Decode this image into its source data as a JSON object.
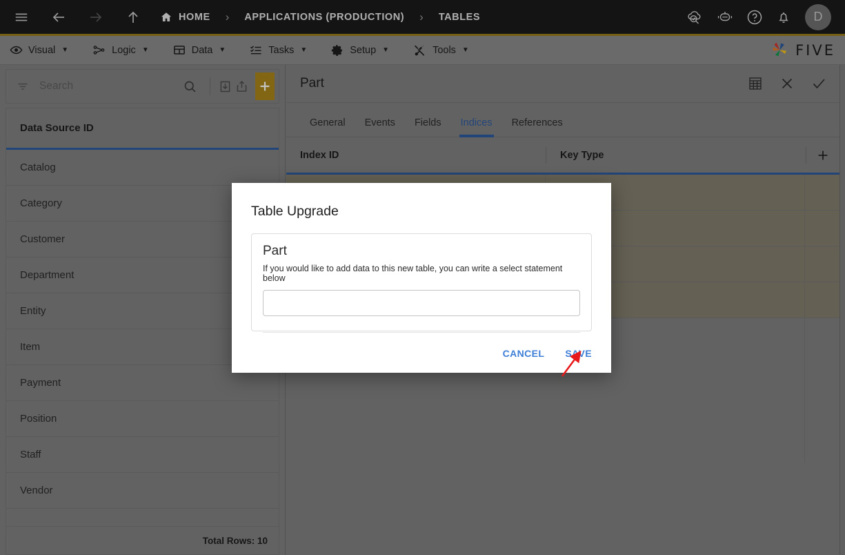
{
  "topbar": {
    "menu_icon": "hamburger-icon",
    "back_icon": "arrow-left-icon",
    "forward_icon": "arrow-right-icon",
    "up_icon": "arrow-up-icon",
    "breadcrumbs": [
      {
        "label": "HOME",
        "icon": "home-icon"
      },
      {
        "label": "APPLICATIONS (PRODUCTION)"
      },
      {
        "label": "TABLES"
      }
    ],
    "separator": "›",
    "right_icons": [
      {
        "name": "cloud-check-icon"
      },
      {
        "name": "robot-assistant-icon"
      },
      {
        "name": "help-icon"
      },
      {
        "name": "notifications-bell-icon"
      }
    ],
    "avatar_initial": "D"
  },
  "menubar": {
    "items": [
      {
        "label": "Visual",
        "icon": "eye-icon"
      },
      {
        "label": "Logic",
        "icon": "workflow-icon"
      },
      {
        "label": "Data",
        "icon": "table-grid-icon"
      },
      {
        "label": "Tasks",
        "icon": "checklist-icon"
      },
      {
        "label": "Setup",
        "icon": "gear-icon"
      },
      {
        "label": "Tools",
        "icon": "tools-icon"
      }
    ],
    "caret": "▼",
    "brand": "FIVE"
  },
  "sidebar": {
    "search": {
      "placeholder": "Search",
      "value": ""
    },
    "toolbar": {
      "filter_icon": "filter-icon",
      "search_icon": "search-icon",
      "import_icon": "import-download-icon",
      "export_icon": "export-share-icon",
      "add_label": "+"
    },
    "list_header": "Data Source ID",
    "items": [
      "Catalog",
      "Category",
      "Customer",
      "Department",
      "Entity",
      "Item",
      "Payment",
      "Position",
      "Staff",
      "Vendor"
    ],
    "footer": "Total Rows: 10"
  },
  "record": {
    "title": "Part",
    "header_icons": [
      {
        "name": "table-view-icon"
      },
      {
        "name": "close-icon"
      },
      {
        "name": "confirm-check-icon"
      }
    ],
    "tabs": [
      {
        "label": "General",
        "active": false
      },
      {
        "label": "Events",
        "active": false
      },
      {
        "label": "Fields",
        "active": false
      },
      {
        "label": "Indices",
        "active": true
      },
      {
        "label": "References",
        "active": false
      }
    ],
    "grid": {
      "columns": [
        "Index ID",
        "Key Type"
      ],
      "add_label": "+",
      "rows": [
        [],
        [],
        [],
        []
      ]
    }
  },
  "dialog": {
    "title": "Table Upgrade",
    "card_title": "Part",
    "card_description": "If you would like to add data to this new table, you can write a select statement below",
    "input_value": "",
    "input_placeholder": "",
    "cancel_label": "CANCEL",
    "save_label": "SAVE"
  },
  "annotation": {
    "arrow_color": "#e8191a",
    "points_to": "SAVE"
  },
  "colors": {
    "topbar_bg": "#1b1b1b",
    "accent_gold": "#9a7b1a",
    "menubar_bg": "#8a8a8a",
    "panel_bg": "#808080",
    "active_blue": "#2d5a9e",
    "link_blue": "#3d7fd6",
    "row_tint": "#827d6d",
    "add_button_bg": "#a9851a"
  }
}
